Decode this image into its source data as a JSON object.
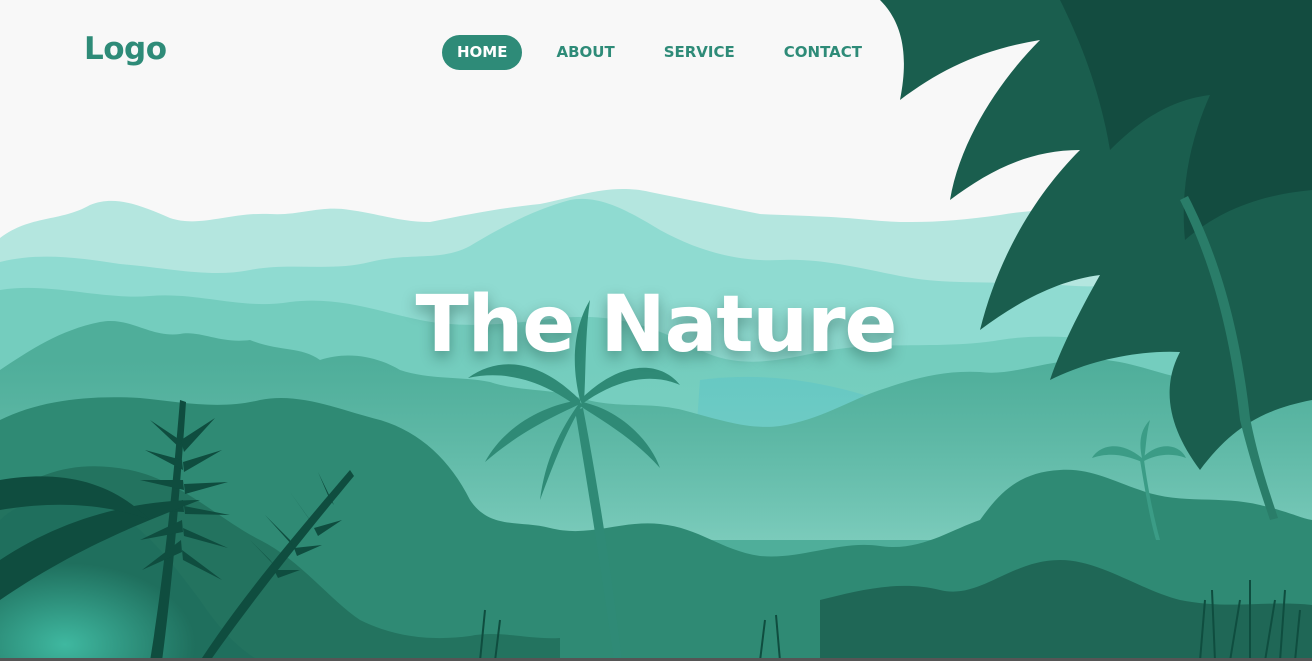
{
  "logo": "Logo",
  "nav": [
    {
      "label": "HOME",
      "active": true
    },
    {
      "label": "ABOUT",
      "active": false
    },
    {
      "label": "SERVICE",
      "active": false
    },
    {
      "label": "CONTACT",
      "active": false
    }
  ],
  "hero": {
    "title": "The Nature"
  },
  "colors": {
    "accent": "#2e8b78",
    "background": "#f8f8f8",
    "mountain_far": "#b4e6df",
    "mountain_mid": "#8fdbd1",
    "forest_mid": "#4fae9a",
    "forest_dark": "#23735f",
    "foliage_darkest": "#0e4a3c"
  },
  "icons": [
    "fern-leaf-icon",
    "palm-tree-icon",
    "grass-icon"
  ]
}
